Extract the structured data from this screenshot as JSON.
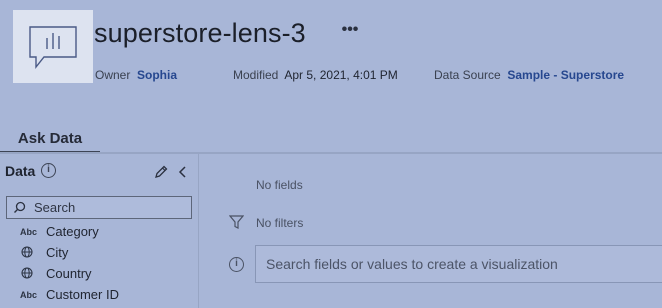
{
  "header": {
    "title": "superstore-lens-3",
    "more_label": "•••",
    "owner_label": "Owner",
    "owner_value": "Sophia",
    "modified_label": "Modified",
    "modified_value": "Apr 5, 2021, 4:01 PM",
    "source_label": "Data Source",
    "source_value": "Sample - Superstore"
  },
  "tabs": [
    {
      "label": "Ask Data"
    }
  ],
  "data_panel": {
    "heading": "Data",
    "info_glyph": "i",
    "search_placeholder": "Search",
    "fields": [
      {
        "type": "Abc",
        "icon": "string",
        "label": "Category"
      },
      {
        "type": "",
        "icon": "globe-icon",
        "label": "City"
      },
      {
        "type": "",
        "icon": "globe-icon",
        "label": "Country"
      },
      {
        "type": "Abc",
        "icon": "string",
        "label": "Customer ID"
      }
    ]
  },
  "main": {
    "empty_fields": "No fields",
    "empty_filters": "No filters",
    "info_glyph": "i",
    "search_placeholder": "Search fields or values to create a visualization"
  }
}
